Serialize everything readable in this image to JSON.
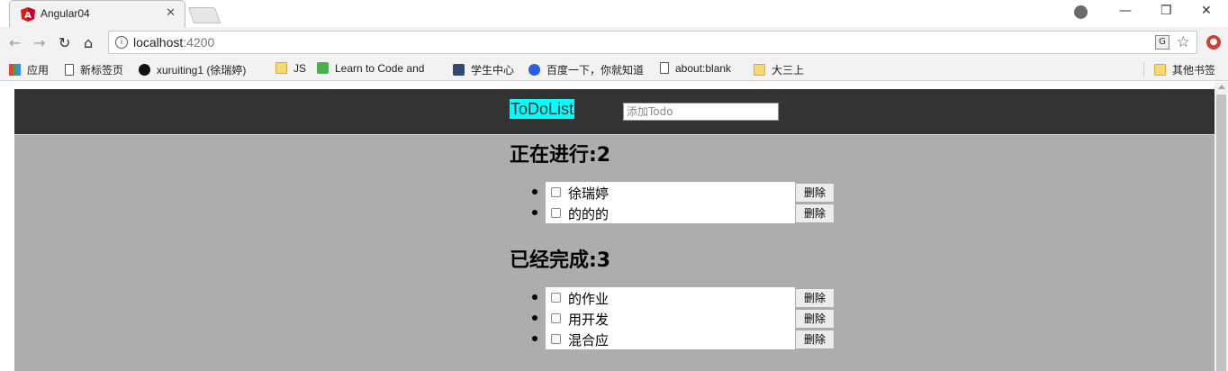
{
  "browser": {
    "tab": {
      "title": "Angular04",
      "favicon": "angular-icon",
      "close_glyph": "✕"
    },
    "window_controls": {
      "minimize": "—",
      "maximize": "❐",
      "close": "✕"
    },
    "address": {
      "host": "localhost",
      "port": ":4200"
    },
    "bookmarks": [
      {
        "label": "应用",
        "icon": "apps-grid-icon"
      },
      {
        "label": "新标签页",
        "icon": "page-icon"
      },
      {
        "label": "xuruiting1 (徐瑞婷)",
        "icon": "github-icon"
      },
      {
        "label": "JS",
        "icon": "folder-icon"
      },
      {
        "label": "Learn to Code and",
        "icon": "freecodecamp-icon"
      },
      {
        "label": "学生中心",
        "icon": "xuesheng-icon"
      },
      {
        "label": "百度一下，你就知道",
        "icon": "baidu-icon"
      },
      {
        "label": "about:blank",
        "icon": "page-icon"
      },
      {
        "label": "大三上",
        "icon": "folder-icon"
      },
      {
        "label": "其他书签",
        "icon": "folder-icon"
      }
    ]
  },
  "app": {
    "header": {
      "title": "ToDoList",
      "input_placeholder": "添加Todo",
      "input_value": ""
    },
    "in_progress": {
      "title": "正在进行:2",
      "items": [
        {
          "text": "徐瑞婷",
          "checked": false,
          "delete_label": "删除"
        },
        {
          "text": "的的的",
          "checked": false,
          "delete_label": "删除"
        }
      ]
    },
    "completed": {
      "title": "已经完成:3",
      "items": [
        {
          "text": "的作业",
          "checked": false,
          "delete_label": "删除"
        },
        {
          "text": "用开发",
          "checked": false,
          "delete_label": "删除"
        },
        {
          "text": "混合应",
          "checked": false,
          "delete_label": "删除"
        }
      ]
    }
  },
  "colors": {
    "header_bg": "#333333",
    "body_bg": "#adadad",
    "title_bg": "#00ffff"
  }
}
